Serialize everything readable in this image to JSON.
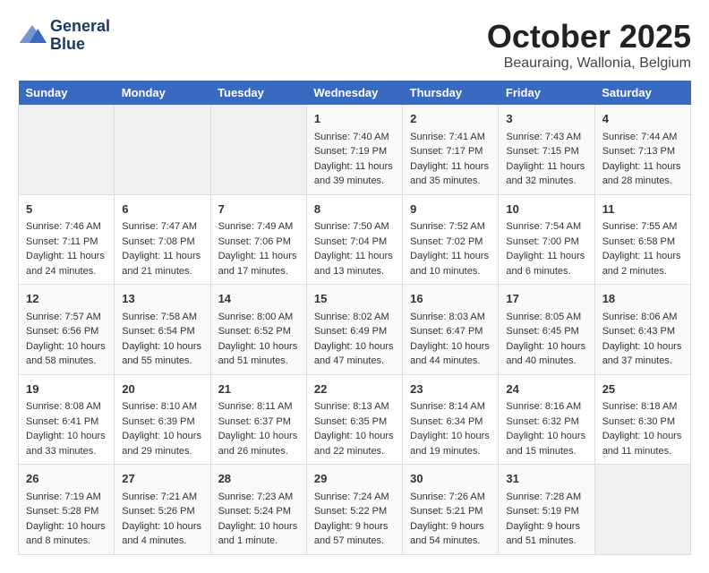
{
  "header": {
    "logo_line1": "General",
    "logo_line2": "Blue",
    "month_title": "October 2025",
    "subtitle": "Beauraing, Wallonia, Belgium"
  },
  "weekdays": [
    "Sunday",
    "Monday",
    "Tuesday",
    "Wednesday",
    "Thursday",
    "Friday",
    "Saturday"
  ],
  "weeks": [
    [
      {
        "day": "",
        "info": ""
      },
      {
        "day": "",
        "info": ""
      },
      {
        "day": "",
        "info": ""
      },
      {
        "day": "1",
        "info": "Sunrise: 7:40 AM\nSunset: 7:19 PM\nDaylight: 11 hours\nand 39 minutes."
      },
      {
        "day": "2",
        "info": "Sunrise: 7:41 AM\nSunset: 7:17 PM\nDaylight: 11 hours\nand 35 minutes."
      },
      {
        "day": "3",
        "info": "Sunrise: 7:43 AM\nSunset: 7:15 PM\nDaylight: 11 hours\nand 32 minutes."
      },
      {
        "day": "4",
        "info": "Sunrise: 7:44 AM\nSunset: 7:13 PM\nDaylight: 11 hours\nand 28 minutes."
      }
    ],
    [
      {
        "day": "5",
        "info": "Sunrise: 7:46 AM\nSunset: 7:11 PM\nDaylight: 11 hours\nand 24 minutes."
      },
      {
        "day": "6",
        "info": "Sunrise: 7:47 AM\nSunset: 7:08 PM\nDaylight: 11 hours\nand 21 minutes."
      },
      {
        "day": "7",
        "info": "Sunrise: 7:49 AM\nSunset: 7:06 PM\nDaylight: 11 hours\nand 17 minutes."
      },
      {
        "day": "8",
        "info": "Sunrise: 7:50 AM\nSunset: 7:04 PM\nDaylight: 11 hours\nand 13 minutes."
      },
      {
        "day": "9",
        "info": "Sunrise: 7:52 AM\nSunset: 7:02 PM\nDaylight: 11 hours\nand 10 minutes."
      },
      {
        "day": "10",
        "info": "Sunrise: 7:54 AM\nSunset: 7:00 PM\nDaylight: 11 hours\nand 6 minutes."
      },
      {
        "day": "11",
        "info": "Sunrise: 7:55 AM\nSunset: 6:58 PM\nDaylight: 11 hours\nand 2 minutes."
      }
    ],
    [
      {
        "day": "12",
        "info": "Sunrise: 7:57 AM\nSunset: 6:56 PM\nDaylight: 10 hours\nand 58 minutes."
      },
      {
        "day": "13",
        "info": "Sunrise: 7:58 AM\nSunset: 6:54 PM\nDaylight: 10 hours\nand 55 minutes."
      },
      {
        "day": "14",
        "info": "Sunrise: 8:00 AM\nSunset: 6:52 PM\nDaylight: 10 hours\nand 51 minutes."
      },
      {
        "day": "15",
        "info": "Sunrise: 8:02 AM\nSunset: 6:49 PM\nDaylight: 10 hours\nand 47 minutes."
      },
      {
        "day": "16",
        "info": "Sunrise: 8:03 AM\nSunset: 6:47 PM\nDaylight: 10 hours\nand 44 minutes."
      },
      {
        "day": "17",
        "info": "Sunrise: 8:05 AM\nSunset: 6:45 PM\nDaylight: 10 hours\nand 40 minutes."
      },
      {
        "day": "18",
        "info": "Sunrise: 8:06 AM\nSunset: 6:43 PM\nDaylight: 10 hours\nand 37 minutes."
      }
    ],
    [
      {
        "day": "19",
        "info": "Sunrise: 8:08 AM\nSunset: 6:41 PM\nDaylight: 10 hours\nand 33 minutes."
      },
      {
        "day": "20",
        "info": "Sunrise: 8:10 AM\nSunset: 6:39 PM\nDaylight: 10 hours\nand 29 minutes."
      },
      {
        "day": "21",
        "info": "Sunrise: 8:11 AM\nSunset: 6:37 PM\nDaylight: 10 hours\nand 26 minutes."
      },
      {
        "day": "22",
        "info": "Sunrise: 8:13 AM\nSunset: 6:35 PM\nDaylight: 10 hours\nand 22 minutes."
      },
      {
        "day": "23",
        "info": "Sunrise: 8:14 AM\nSunset: 6:34 PM\nDaylight: 10 hours\nand 19 minutes."
      },
      {
        "day": "24",
        "info": "Sunrise: 8:16 AM\nSunset: 6:32 PM\nDaylight: 10 hours\nand 15 minutes."
      },
      {
        "day": "25",
        "info": "Sunrise: 8:18 AM\nSunset: 6:30 PM\nDaylight: 10 hours\nand 11 minutes."
      }
    ],
    [
      {
        "day": "26",
        "info": "Sunrise: 7:19 AM\nSunset: 5:28 PM\nDaylight: 10 hours\nand 8 minutes."
      },
      {
        "day": "27",
        "info": "Sunrise: 7:21 AM\nSunset: 5:26 PM\nDaylight: 10 hours\nand 4 minutes."
      },
      {
        "day": "28",
        "info": "Sunrise: 7:23 AM\nSunset: 5:24 PM\nDaylight: 10 hours\nand 1 minute."
      },
      {
        "day": "29",
        "info": "Sunrise: 7:24 AM\nSunset: 5:22 PM\nDaylight: 9 hours\nand 57 minutes."
      },
      {
        "day": "30",
        "info": "Sunrise: 7:26 AM\nSunset: 5:21 PM\nDaylight: 9 hours\nand 54 minutes."
      },
      {
        "day": "31",
        "info": "Sunrise: 7:28 AM\nSunset: 5:19 PM\nDaylight: 9 hours\nand 51 minutes."
      },
      {
        "day": "",
        "info": ""
      }
    ]
  ]
}
